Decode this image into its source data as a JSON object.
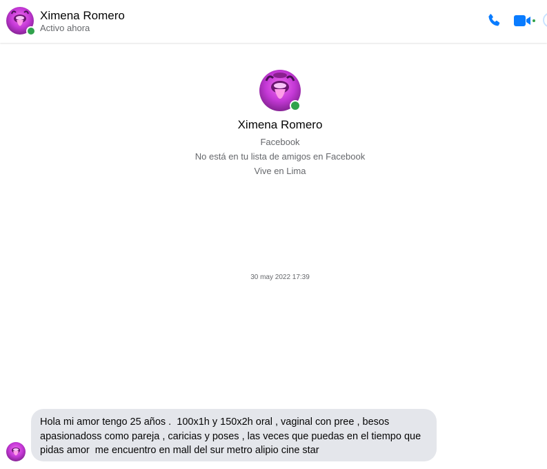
{
  "header": {
    "contact_name": "Ximena Romero",
    "status": "Activo ahora",
    "actions": [
      {
        "label": "",
        "icon": "phone-icon"
      },
      {
        "label": "",
        "icon": "video-camera-icon"
      }
    ]
  },
  "profile": {
    "name": "Ximena Romero",
    "source": "Facebook",
    "friend_status": "No está en tu lista de amigos en Facebook",
    "location": "Vive en Lima"
  },
  "conversation": {
    "timestamp": "30 may 2022 17:39",
    "messages": [
      {
        "sender": "Ximena Romero",
        "lines": [
          "Hola mi amor tengo 25 años .  100x1h y 150x2h oral , vaginal con pree , besos",
          "apasionadoss como pareja , caricias y poses , las veces que puedas en el tiempo que",
          "pidas amor  me encuentro en mall del sur metro alipio cine star"
        ]
      }
    ]
  },
  "colors": {
    "accent": "#0a7cff",
    "online": "#31a24c",
    "bubble": "#e4e6eb",
    "secondary_text": "#65676b"
  }
}
